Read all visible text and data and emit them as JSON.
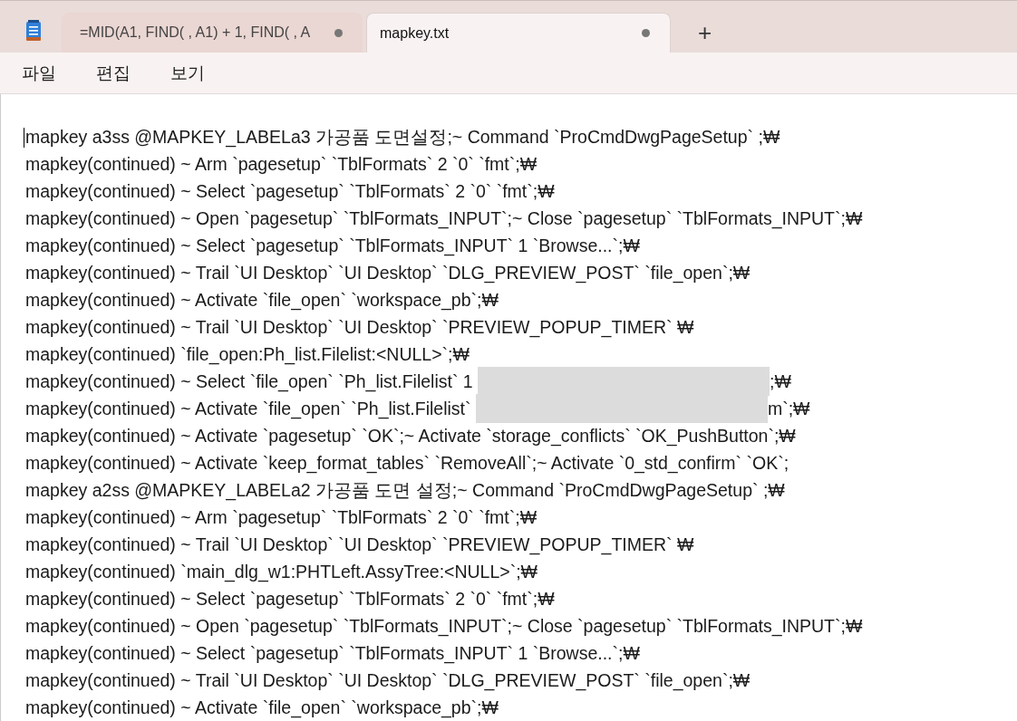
{
  "tabs": [
    {
      "title": "=MID(A1, FIND( , A1) + 1, FIND( , A",
      "selected": false,
      "modified": true
    },
    {
      "title": "mapkey.txt",
      "selected": true,
      "modified": true
    }
  ],
  "new_tab": "+",
  "menu": [
    "파일",
    "편집",
    "보기"
  ],
  "editor": {
    "caret": true,
    "lines": [
      {
        "kind": "plain",
        "text": "mapkey a3ss @MAPKEY_LABELa3 가공품 도면설정;~ Command `ProCmdDwgPageSetup` ;₩"
      },
      {
        "kind": "plain",
        "text": "mapkey(continued) ~ Arm `pagesetup` `TblFormats` 2 `0` `fmt`;₩"
      },
      {
        "kind": "plain",
        "text": "mapkey(continued) ~ Select `pagesetup` `TblFormats` 2 `0` `fmt`;₩"
      },
      {
        "kind": "plain",
        "text": "mapkey(continued) ~ Open `pagesetup` `TblFormats_INPUT`;~ Close `pagesetup` `TblFormats_INPUT`;₩"
      },
      {
        "kind": "plain",
        "text": "mapkey(continued) ~ Select `pagesetup` `TblFormats_INPUT` 1 `Browse...`;₩"
      },
      {
        "kind": "plain",
        "text": "mapkey(continued) ~ Trail `UI Desktop` `UI Desktop` `DLG_PREVIEW_POST` `file_open`;₩"
      },
      {
        "kind": "plain",
        "text": "mapkey(continued) ~ Activate `file_open` `workspace_pb`;₩"
      },
      {
        "kind": "plain",
        "text": "mapkey(continued) ~ Trail `UI Desktop` `UI Desktop` `PREVIEW_POPUP_TIMER` ₩"
      },
      {
        "kind": "plain",
        "text": "mapkey(continued) `file_open:Ph_list.Filelist:<NULL>`;₩"
      },
      {
        "kind": "redacted",
        "before": "mapkey(continued) ~ Select `file_open` `Ph_list.Filelist` 1 ",
        "after": ";₩"
      },
      {
        "kind": "redacted",
        "before": "mapkey(continued) ~ Activate `file_open` `Ph_list.Filelist` ",
        "after": "m`;₩"
      },
      {
        "kind": "plain",
        "text": "mapkey(continued) ~ Activate `pagesetup` `OK`;~ Activate `storage_conflicts` `OK_PushButton`;₩"
      },
      {
        "kind": "plain",
        "text": "mapkey(continued) ~ Activate `keep_format_tables` `RemoveAll`;~ Activate `0_std_confirm` `OK`;"
      },
      {
        "kind": "plain",
        "text": "mapkey a2ss @MAPKEY_LABELa2 가공품 도면 설정;~ Command `ProCmdDwgPageSetup` ;₩"
      },
      {
        "kind": "plain",
        "text": "mapkey(continued) ~ Arm `pagesetup` `TblFormats` 2 `0` `fmt`;₩"
      },
      {
        "kind": "plain",
        "text": "mapkey(continued) ~ Trail `UI Desktop` `UI Desktop` `PREVIEW_POPUP_TIMER` ₩"
      },
      {
        "kind": "plain",
        "text": "mapkey(continued) `main_dlg_w1:PHTLeft.AssyTree:<NULL>`;₩"
      },
      {
        "kind": "plain",
        "text": "mapkey(continued) ~ Select `pagesetup` `TblFormats` 2 `0` `fmt`;₩"
      },
      {
        "kind": "plain",
        "text": "mapkey(continued) ~ Open `pagesetup` `TblFormats_INPUT`;~ Close `pagesetup` `TblFormats_INPUT`;₩"
      },
      {
        "kind": "plain",
        "text": "mapkey(continued) ~ Select `pagesetup` `TblFormats_INPUT` 1 `Browse...`;₩"
      },
      {
        "kind": "plain",
        "text": "mapkey(continued) ~ Trail `UI Desktop` `UI Desktop` `DLG_PREVIEW_POST` `file_open`;₩"
      },
      {
        "kind": "plain",
        "text": "mapkey(continued) ~ Activate `file_open` `workspace_pb`;₩"
      }
    ]
  }
}
